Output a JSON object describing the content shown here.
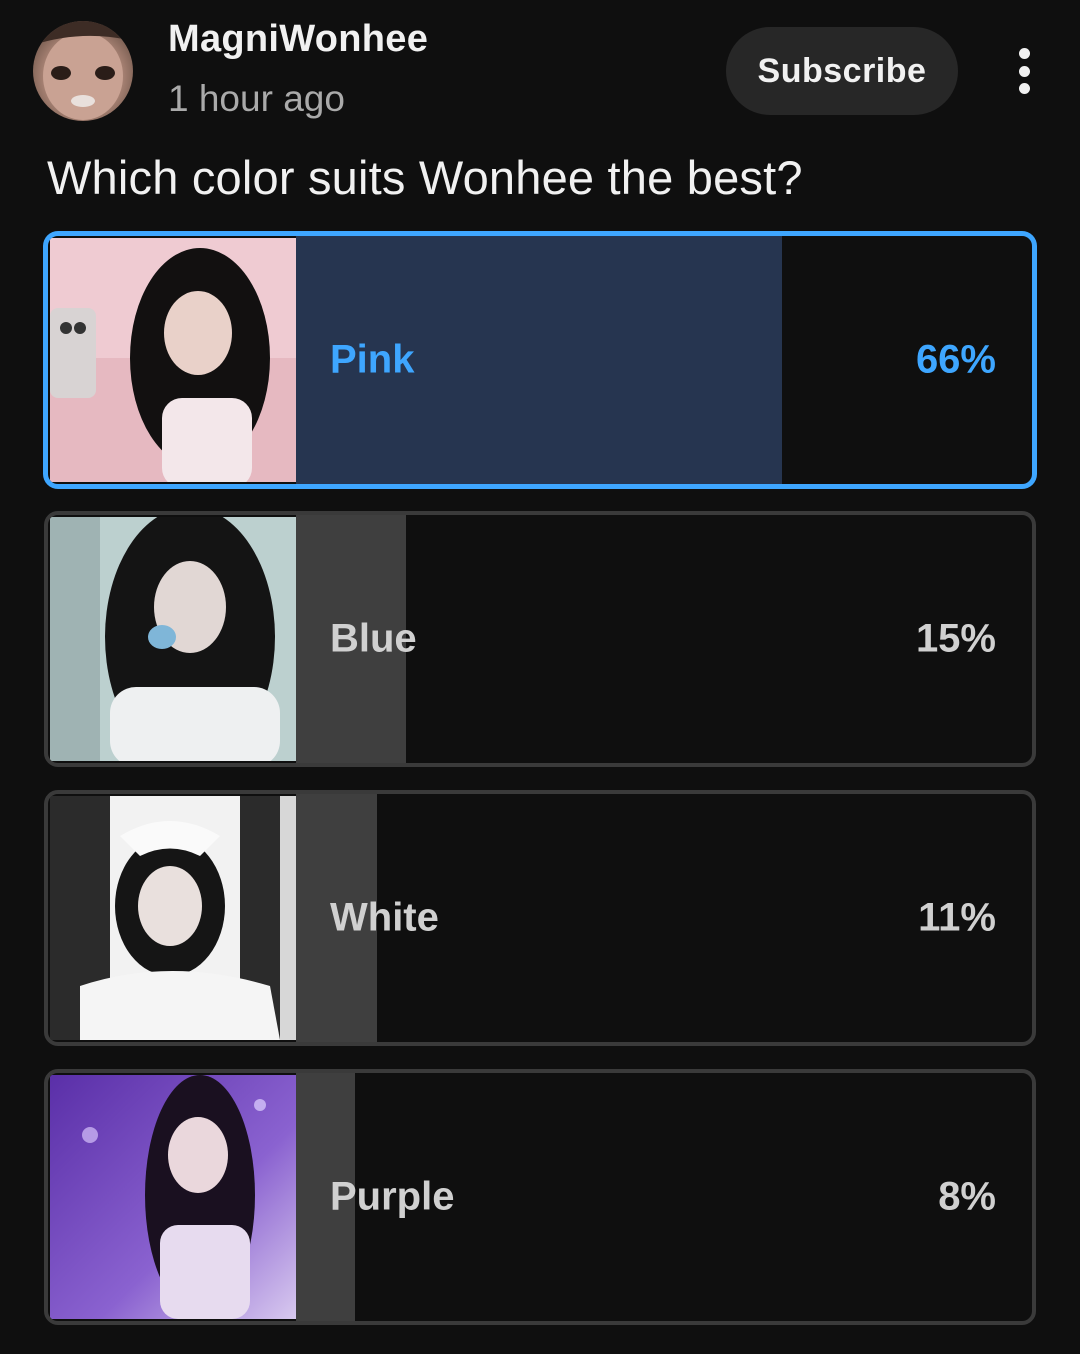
{
  "post": {
    "channel_name": "MagniWonhee",
    "timestamp": "1 hour ago",
    "subscribe_label": "Subscribe",
    "question": "Which color suits Wonhee the best?"
  },
  "poll": {
    "options": [
      {
        "label": "Pink",
        "percent": "66%",
        "value": 66,
        "selected": true
      },
      {
        "label": "Blue",
        "percent": "15%",
        "value": 15,
        "selected": false
      },
      {
        "label": "White",
        "percent": "11%",
        "value": 11,
        "selected": false
      },
      {
        "label": "Purple",
        "percent": "8%",
        "value": 8,
        "selected": false
      }
    ]
  },
  "colors": {
    "background": "#0f0f0f",
    "accent": "#3ea6ff",
    "selected_fill": "#263550",
    "fill": "#3f3f3f",
    "subscribe_bg": "#272727"
  },
  "icons": {
    "more": "more-vert-icon"
  }
}
